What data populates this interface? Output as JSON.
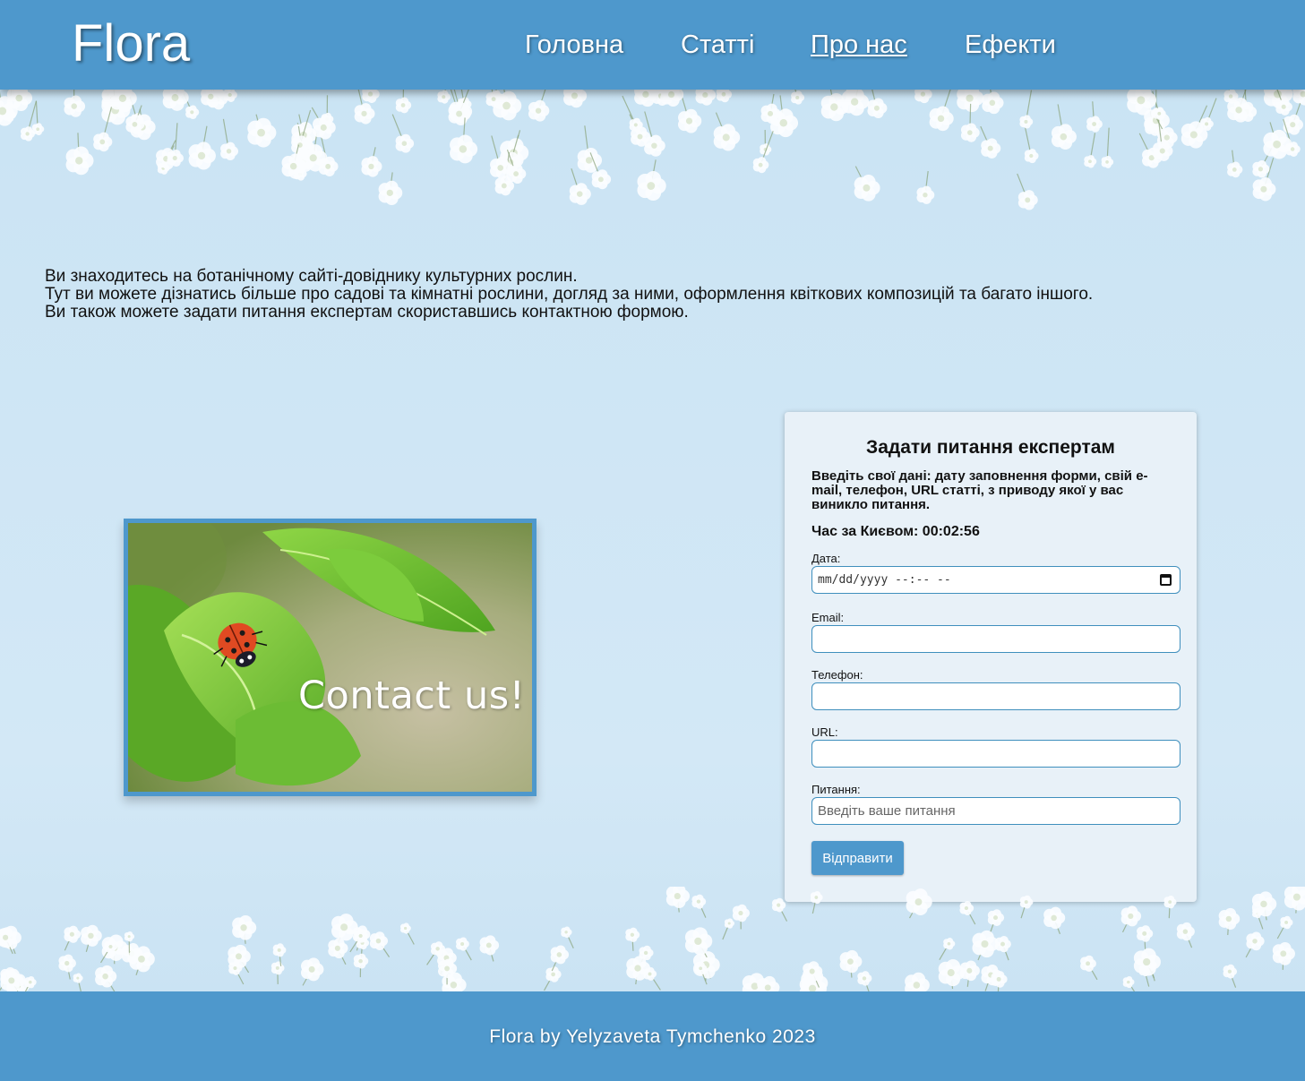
{
  "site": {
    "logo": "Flora"
  },
  "nav": [
    {
      "label": "Головна"
    },
    {
      "label": "Статті"
    },
    {
      "label": "Про нас",
      "active": true
    },
    {
      "label": "Ефекти"
    }
  ],
  "intro": {
    "lines": [
      "Ви знаходитесь на ботанічному сайті-довіднику культурних рослин.",
      "Тут ви можете дізнатись більше про садові та кімнатні рослини, догляд за ними, оформлення квіткових композицій та багато іншого.",
      "Ви також можете задати питання експертам скориставшись контактною формою."
    ]
  },
  "contact_image": {
    "caption": "Contact us!"
  },
  "form": {
    "title": "Задати питання експертам",
    "description": "Введіть свої дані: дату заповнення форми, свій e-mail, телефон, URL статті, з приводу якої у вас виникло питання.",
    "time_label": "Час за Києвом: 00:02:56",
    "fields": [
      {
        "label": "Дата:",
        "value": "mm/dd/yyyy --:-- --"
      },
      {
        "label": "Email:",
        "value": ""
      },
      {
        "label": "Телефон:",
        "value": ""
      },
      {
        "label": "URL:",
        "value": ""
      },
      {
        "label": "Питання:",
        "placeholder": "Введіть ваше питання"
      }
    ],
    "submit_label": "Відправити"
  },
  "footer": {
    "text": "Flora by Yelyzaveta Tymchenko 2023"
  },
  "colors": {
    "accent": "#4e98cc",
    "card": "#e8f1f8",
    "background": "#cfe6f5"
  },
  "icons": {
    "date": "calendar-icon"
  }
}
